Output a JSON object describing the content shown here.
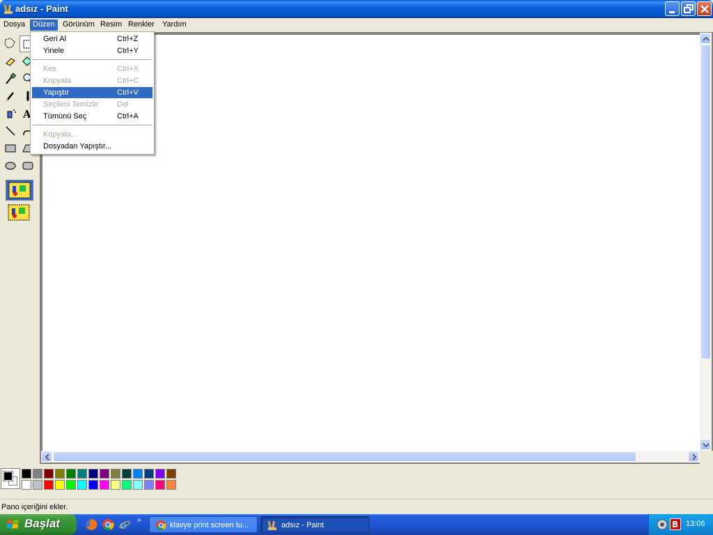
{
  "window": {
    "title": "adsız - Paint",
    "icon": "paint-app-icon"
  },
  "menubar": {
    "items": [
      "Dosya",
      "Düzen",
      "Görünüm",
      "Resim",
      "Renkler",
      "Yardım"
    ],
    "active": "Düzen"
  },
  "edit_menu": {
    "items": [
      {
        "label": "Geri Al",
        "shortcut": "Ctrl+Z",
        "enabled": true
      },
      {
        "label": "Yinele",
        "shortcut": "Ctrl+Y",
        "enabled": true
      },
      {
        "label": "Kes",
        "shortcut": "Ctrl+X",
        "enabled": false
      },
      {
        "label": "Kopyala",
        "shortcut": "Ctrl+C",
        "enabled": false
      },
      {
        "label": "Yapıştır",
        "shortcut": "Ctrl+V",
        "enabled": true,
        "highlighted": true
      },
      {
        "label": "Seçileni Temizle",
        "shortcut": "Del",
        "enabled": false
      },
      {
        "label": "Tümünü Seç",
        "shortcut": "Ctrl+A",
        "enabled": true
      },
      {
        "label": "Kopyala...",
        "shortcut": "",
        "enabled": false
      },
      {
        "label": "Dosyadan Yapıştır...",
        "shortcut": "",
        "enabled": true
      }
    ]
  },
  "toolbox": {
    "tools": [
      "free-form-select",
      "select",
      "eraser",
      "fill-with-color",
      "pick-color",
      "magnifier",
      "pencil",
      "brush",
      "airbrush",
      "text",
      "line",
      "curve",
      "rectangle",
      "polygon",
      "ellipse",
      "rounded-rectangle"
    ],
    "selected": "select"
  },
  "palette": {
    "foreground": "#000000",
    "background": "#ffffff",
    "row1": [
      "#000000",
      "#808080",
      "#800000",
      "#808000",
      "#008000",
      "#008080",
      "#000080",
      "#800080",
      "#808040",
      "#004040",
      "#0080ff",
      "#004080",
      "#8000ff",
      "#804000"
    ],
    "row2": [
      "#ffffff",
      "#c0c0c0",
      "#ff0000",
      "#ffff00",
      "#00ff00",
      "#00ffff",
      "#0000ff",
      "#ff00ff",
      "#ffff80",
      "#00ff80",
      "#80ffff",
      "#8080ff",
      "#ff0080",
      "#ff8040"
    ]
  },
  "statusbar": {
    "text": "Pano içeriğini ekler."
  },
  "taskbar": {
    "start_label": "Başlat",
    "quick_launch": [
      "firefox-icon",
      "chrome-icon",
      "internet-explorer-icon"
    ],
    "tasks": [
      {
        "label": "klavye print screen tu...",
        "icon": "chrome-icon",
        "active": false
      },
      {
        "label": "adsız - Paint",
        "icon": "paint-app-icon",
        "active": true
      }
    ],
    "tray_icons": [
      "security-shield-icon",
      "b-app-icon"
    ],
    "clock": "13:06"
  }
}
